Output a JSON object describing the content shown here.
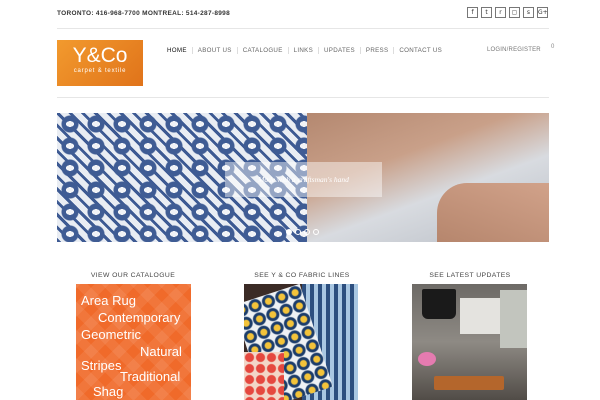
{
  "topbar": {
    "contact": "TORONTO: 416-968-7700 MONTREAL: 514-287-8998",
    "social_icons": [
      {
        "name": "facebook-icon",
        "glyph": "f"
      },
      {
        "name": "twitter-icon",
        "glyph": "t"
      },
      {
        "name": "rss-icon",
        "glyph": "r"
      },
      {
        "name": "instagram-icon",
        "glyph": "▢"
      },
      {
        "name": "skype-icon",
        "glyph": "s"
      },
      {
        "name": "googleplus-icon",
        "glyph": "G+"
      }
    ]
  },
  "logo": {
    "brand": "Y&Co",
    "tagline": "carpet & textile"
  },
  "nav": {
    "items": [
      "HOME",
      "ABOUT US",
      "CATALOGUE",
      "LINKS",
      "UPDATES",
      "PRESS",
      "CONTACT US"
    ],
    "active_index": 0,
    "login": "LOGIN/REGISTER",
    "cart_count": "0"
  },
  "slider": {
    "caption": "Made with a craftsman's hand",
    "slide_count": 4,
    "active_slide": 0
  },
  "columns": [
    {
      "title": "VIEW OUR CATALOGUE"
    },
    {
      "title": "SEE Y & CO FABRIC LINES"
    },
    {
      "title": "SEE LATEST UPDATES"
    }
  ],
  "catalogue_words": [
    "Area Rug",
    "Contemporary",
    "Geometric",
    "Natural",
    "Stripes",
    "Traditional",
    "Shag"
  ],
  "colors": {
    "brand_orange": "#f0891f",
    "catalogue_orange": "#f06a2a"
  }
}
